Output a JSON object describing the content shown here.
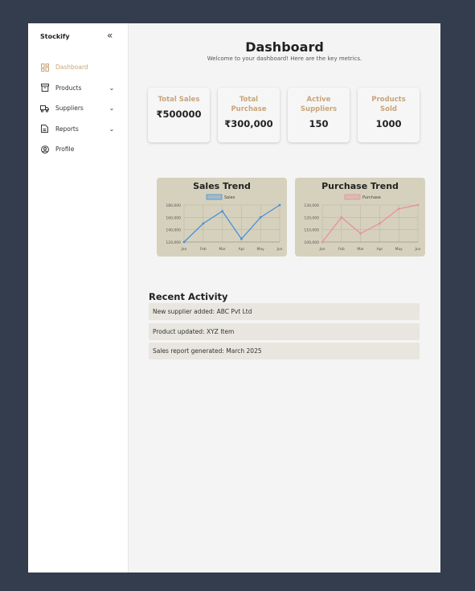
{
  "sidebar": {
    "brand": "Stockify",
    "items": [
      {
        "label": "Dashboard",
        "icon": "grid-icon",
        "active": true,
        "has_chevron": false
      },
      {
        "label": "Products",
        "icon": "archive-icon",
        "active": false,
        "has_chevron": true
      },
      {
        "label": "Suppliers",
        "icon": "truck-icon",
        "active": false,
        "has_chevron": true
      },
      {
        "label": "Reports",
        "icon": "document-icon",
        "active": false,
        "has_chevron": true
      },
      {
        "label": "Profile",
        "icon": "user-circle-icon",
        "active": false,
        "has_chevron": false
      }
    ]
  },
  "header": {
    "title": "Dashboard",
    "subtitle": "Welcome to your dashboard! Here are the key metrics."
  },
  "cards": [
    {
      "label_lines": [
        "Total Sales"
      ],
      "value": "₹500000"
    },
    {
      "label_lines": [
        "Total",
        "Purchase"
      ],
      "value": "₹300,000"
    },
    {
      "label_lines": [
        "Active",
        "Suppliers"
      ],
      "value": "150"
    },
    {
      "label_lines": [
        "Products",
        "Sold"
      ],
      "value": "1000"
    }
  ],
  "colors": {
    "accent": "#c9a57a",
    "sales_line": "#4a90d9",
    "purchase_line": "#e8909a",
    "chart_bg": "#d6d1bd",
    "sidebar_bg": "#ffffff",
    "page_bg": "#333d4e"
  },
  "chart_data": [
    {
      "type": "line",
      "title": "Sales Trend",
      "categories": [
        "Jan",
        "Feb",
        "Mar",
        "Apr",
        "May",
        "Jun"
      ],
      "series": [
        {
          "name": "Sales",
          "values": [
            120000,
            150000,
            170000,
            125000,
            160000,
            180000
          ]
        }
      ],
      "yticks": [
        "180,000",
        "160,000",
        "140,000",
        "120,000"
      ],
      "ylim": [
        120000,
        180000
      ],
      "grid": true,
      "legend": "top-center"
    },
    {
      "type": "line",
      "title": "Purchase Trend",
      "categories": [
        "Jan",
        "Feb",
        "Mar",
        "Apr",
        "May",
        "Jun"
      ],
      "series": [
        {
          "name": "Purchase",
          "values": [
            100000,
            120000,
            107000,
            115000,
            127000,
            130000
          ]
        }
      ],
      "yticks": [
        "130,000",
        "120,000",
        "110,000",
        "100,000"
      ],
      "ylim": [
        100000,
        130000
      ],
      "grid": true,
      "legend": "top-center"
    }
  ],
  "recent": {
    "title": "Recent Activity",
    "items": [
      "New supplier added: ABC Pvt Ltd",
      "Product updated: XYZ Item",
      "Sales report generated: March 2025"
    ]
  }
}
